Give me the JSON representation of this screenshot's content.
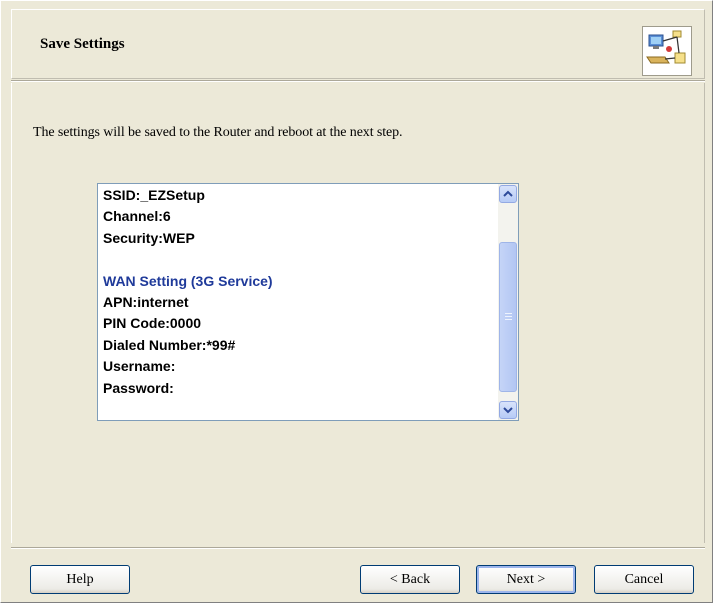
{
  "header": {
    "title": "Save Settings",
    "icon": "network-router-icon"
  },
  "intro_text": "The settings will be saved to the Router and reboot at the next step.",
  "settings_list": {
    "lines": [
      {
        "text": "SSID:_EZSetup",
        "type": "item"
      },
      {
        "text": "Channel:6",
        "type": "item"
      },
      {
        "text": "Security:WEP",
        "type": "item"
      },
      {
        "text": "",
        "type": "blank"
      },
      {
        "text": "WAN Setting (3G Service)",
        "type": "heading"
      },
      {
        "text": "APN:internet",
        "type": "item"
      },
      {
        "text": "PIN Code:0000",
        "type": "item"
      },
      {
        "text": "Dialed Number:*99#",
        "type": "item"
      },
      {
        "text": "Username:",
        "type": "item"
      },
      {
        "text": "Password:",
        "type": "item"
      }
    ],
    "scroll_up_icon": "chevron-up-icon",
    "scroll_down_icon": "chevron-down-icon"
  },
  "buttons": {
    "help": "Help",
    "back": "< Back",
    "next": "Next >",
    "cancel": "Cancel"
  },
  "colors": {
    "dialog_bg": "#ece9d8",
    "heading_text": "#1f3a9a",
    "button_border": "#003c74"
  }
}
